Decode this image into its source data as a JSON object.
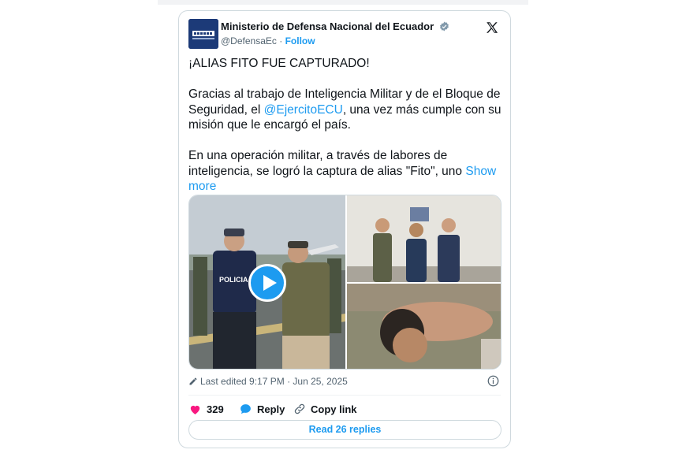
{
  "author": {
    "name": "Ministerio de Defensa Nacional del Ecuador",
    "handle": "@DefensaEc",
    "separator": "·",
    "follow_label": "Follow"
  },
  "tweet": {
    "headline": "¡ALIAS FITO FUE CAPTURADO!",
    "paragraph1": {
      "before": "Gracias al trabajo de Inteligencia Militar y de el Bloque de Seguridad, el ",
      "mention": "@EjercitoECU",
      "after": ", una vez más cumple con su misión que le encargó el país."
    },
    "paragraph2": {
      "text": "En una operación militar, a través de labores de inteligencia, se logró la captura de alias \"Fito\", uno ",
      "show_more": "Show more"
    }
  },
  "media": {
    "video_vest_text": "POLICIA",
    "play_icon": "play-icon"
  },
  "meta": {
    "edited": "Last edited 9:17 PM · Jun 25, 2025"
  },
  "actions": {
    "like_count": "329",
    "reply_label": "Reply",
    "copy_label": "Copy link",
    "read_replies": "Read 26 replies"
  },
  "colors": {
    "accent": "#1d9bf0",
    "like": "#f91880",
    "text": "#0f1419",
    "muted": "#536471"
  }
}
